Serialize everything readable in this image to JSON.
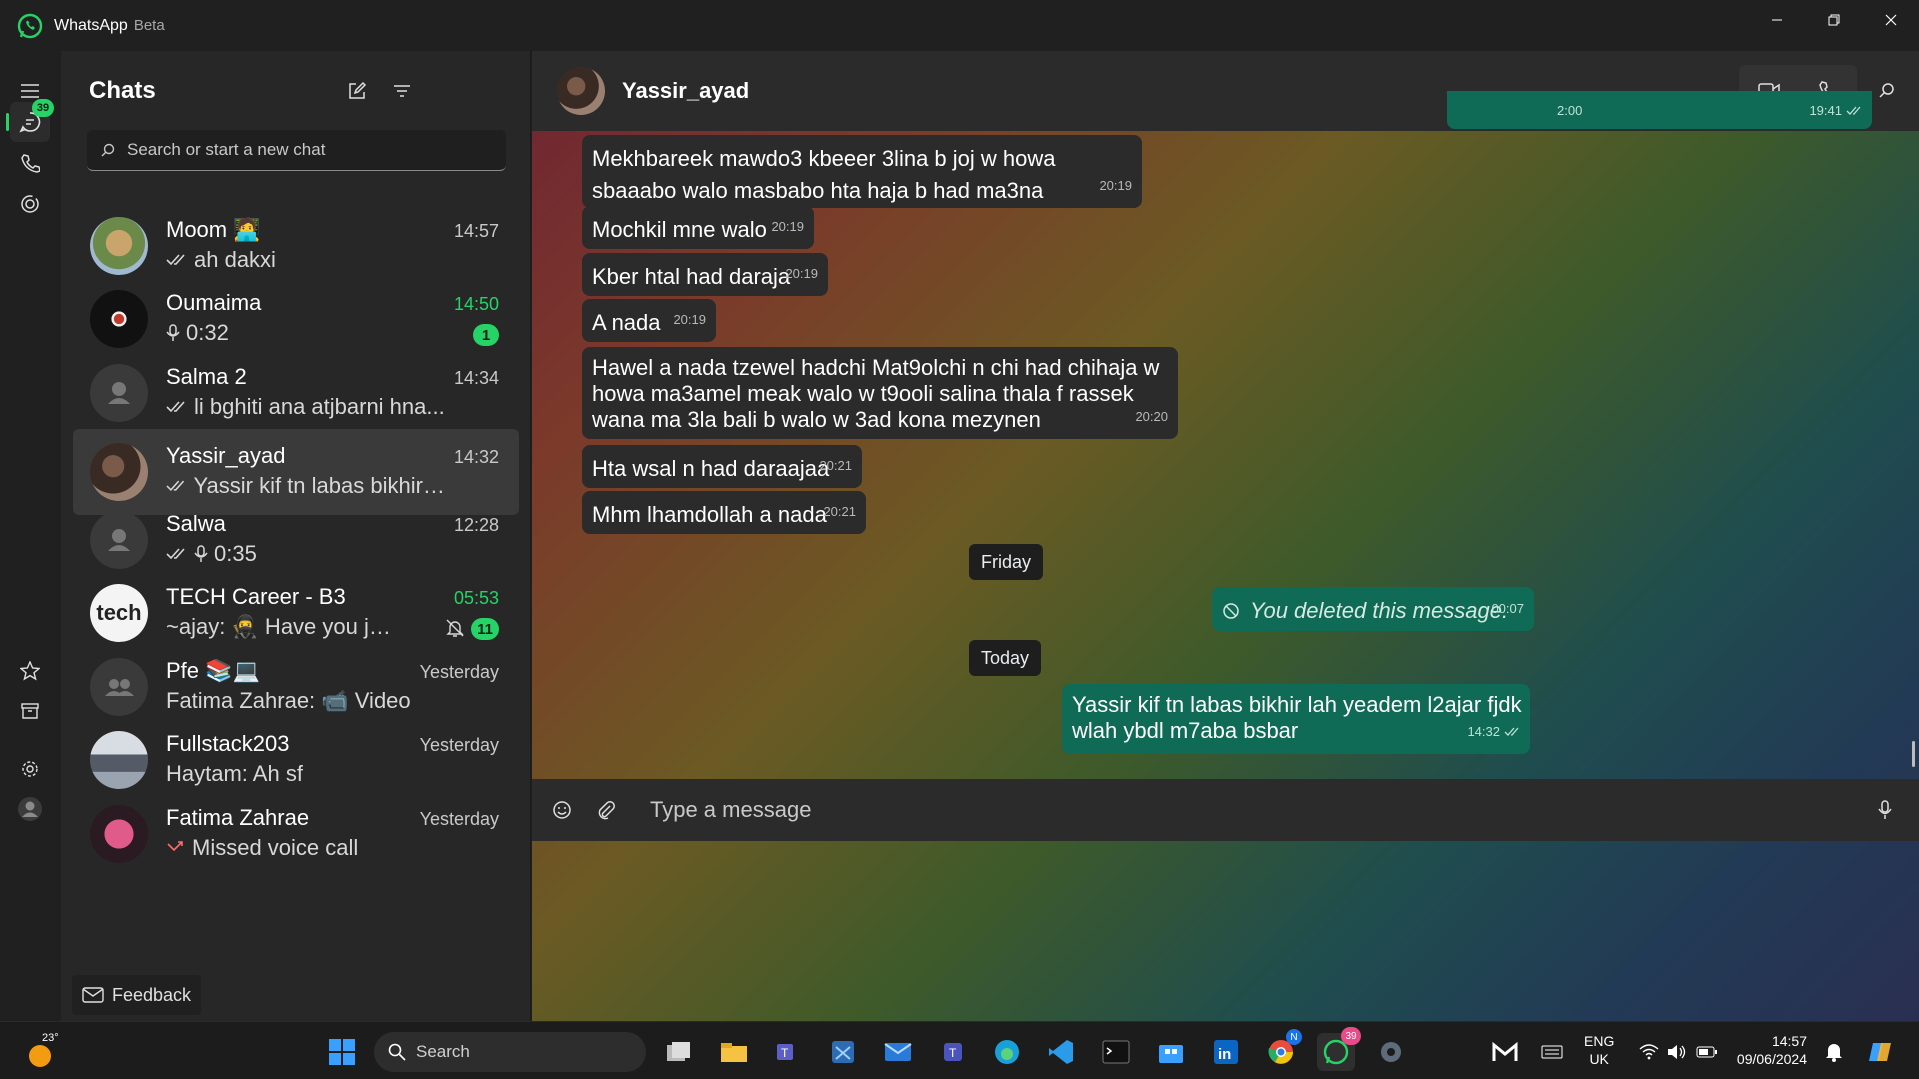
{
  "window": {
    "title": "WhatsApp",
    "beta": "Beta"
  },
  "rail": {
    "chats_badge": "39"
  },
  "chatlist": {
    "title": "Chats",
    "search_placeholder": "Search or start a new chat",
    "chats": [
      {
        "name": "Moom 🧑‍💻",
        "time": "14:57",
        "preview": "ah dakxi",
        "ticks": true
      },
      {
        "name": "Oumaima",
        "time": "14:50",
        "preview": "0:32",
        "voice": true,
        "unread": "1",
        "time_green": true
      },
      {
        "name": "Salma  2",
        "time": "14:34",
        "preview": "li bghiti ana atjbarni hna...",
        "ticks": true
      },
      {
        "name": "Yassir_ayad",
        "time": "14:32",
        "preview": "Yassir kif tn labas bikhir l...",
        "ticks": true,
        "selected": true
      },
      {
        "name": "Salwa",
        "time": "12:28",
        "preview": "0:35",
        "ticks": true,
        "voice": true
      },
      {
        "name": "TECH Career - B3",
        "time": "05:53",
        "preview": "~ajay: 🥷 Have you joi...",
        "unread": "11",
        "muted": true,
        "time_green": true
      },
      {
        "name": "Pfe 📚💻",
        "time": "Yesterday",
        "preview": "Fatima Zahrae: 📹 Video"
      },
      {
        "name": "Fullstack203",
        "time": "Yesterday",
        "preview": "Haytam: Ah sf"
      },
      {
        "name": "Fatima Zahrae",
        "time": "Yesterday",
        "preview": "Missed voice call",
        "missed": true
      }
    ],
    "feedback": "Feedback"
  },
  "conversation": {
    "contact": "Yassir_ayad",
    "top_partial": {
      "left": "2:00",
      "right": "19:41"
    },
    "messages": [
      {
        "dir": "in",
        "text": "Mekhbareek mawdo3 kbeeer 3lina b joj w howa sbaaabo walo masbabo hta haja b had ma3na",
        "time": "20:19"
      },
      {
        "dir": "in",
        "text": "Mochkil mne walo",
        "time": "20:19"
      },
      {
        "dir": "in",
        "text": "Kber htal had daraja",
        "time": "20:19"
      },
      {
        "dir": "in",
        "text": "A nada",
        "time": "20:19"
      },
      {
        "dir": "in",
        "text": "Hawel a nada tzewel hadchi Mat9olchi n chi had chihaja w howa ma3amel meak walo w t9ooli salina thala f rassek wana ma 3la bali b walo w 3ad kona mezynen",
        "time": "20:20"
      },
      {
        "dir": "in",
        "text": "Hta wsal n had daraajaa",
        "time": "20:21"
      },
      {
        "dir": "in",
        "text": "Mhm lhamdollah a nada",
        "time": "20:21"
      }
    ],
    "day_friday": "Friday",
    "deleted": {
      "text": "You deleted this message.",
      "time": "00:07"
    },
    "day_today": "Today",
    "last_out": {
      "text": "Yassir kif tn labas bikhir lah yeadem l2ajar fjdk wlah ybdl m7aba bsbar",
      "time": "14:32"
    },
    "composer_placeholder": "Type a message"
  },
  "taskbar": {
    "weather": "23°",
    "search": "Search",
    "whatsapp_badge": "39",
    "chrome_badge": "N",
    "lang": "ENG",
    "region": "UK",
    "time": "14:57",
    "date": "09/06/2024"
  }
}
